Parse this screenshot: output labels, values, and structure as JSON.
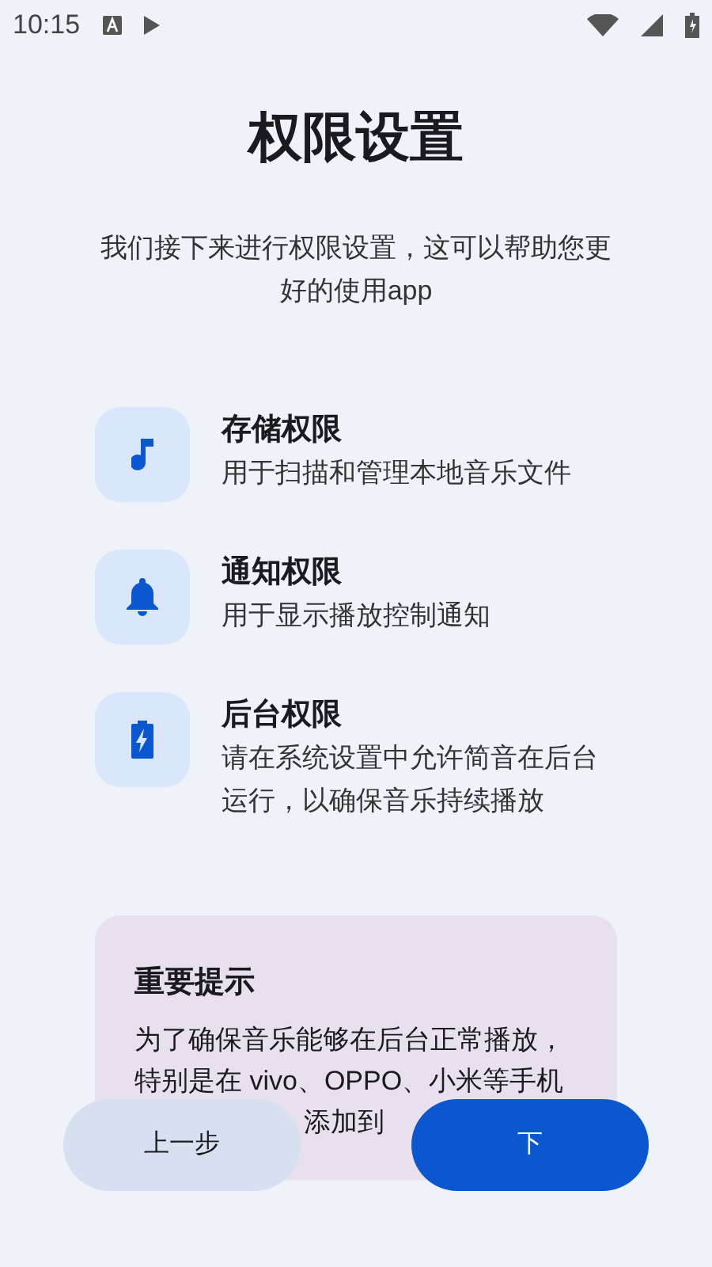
{
  "status_bar": {
    "time": "10:15"
  },
  "title": "权限设置",
  "subtitle": "我们接下来进行权限设置，这可以帮助您更好的使用app",
  "permissions": [
    {
      "kind": "music",
      "title": "存储权限",
      "description": "用于扫描和管理本地音乐文件"
    },
    {
      "kind": "bell",
      "title": "通知权限",
      "description": "用于显示播放控制通知"
    },
    {
      "kind": "battery",
      "title": "后台权限",
      "description": "请在系统设置中允许简音在后台运行，以确保音乐持续播放"
    }
  ],
  "notice": {
    "title": "重要提示",
    "lines": [
      "为了确保音乐能够在后台正常播放，",
      "特别是在 vivo、OPPO、小米等手机",
      "添加到"
    ]
  },
  "buttons": {
    "back": "上一步",
    "next": "下"
  }
}
